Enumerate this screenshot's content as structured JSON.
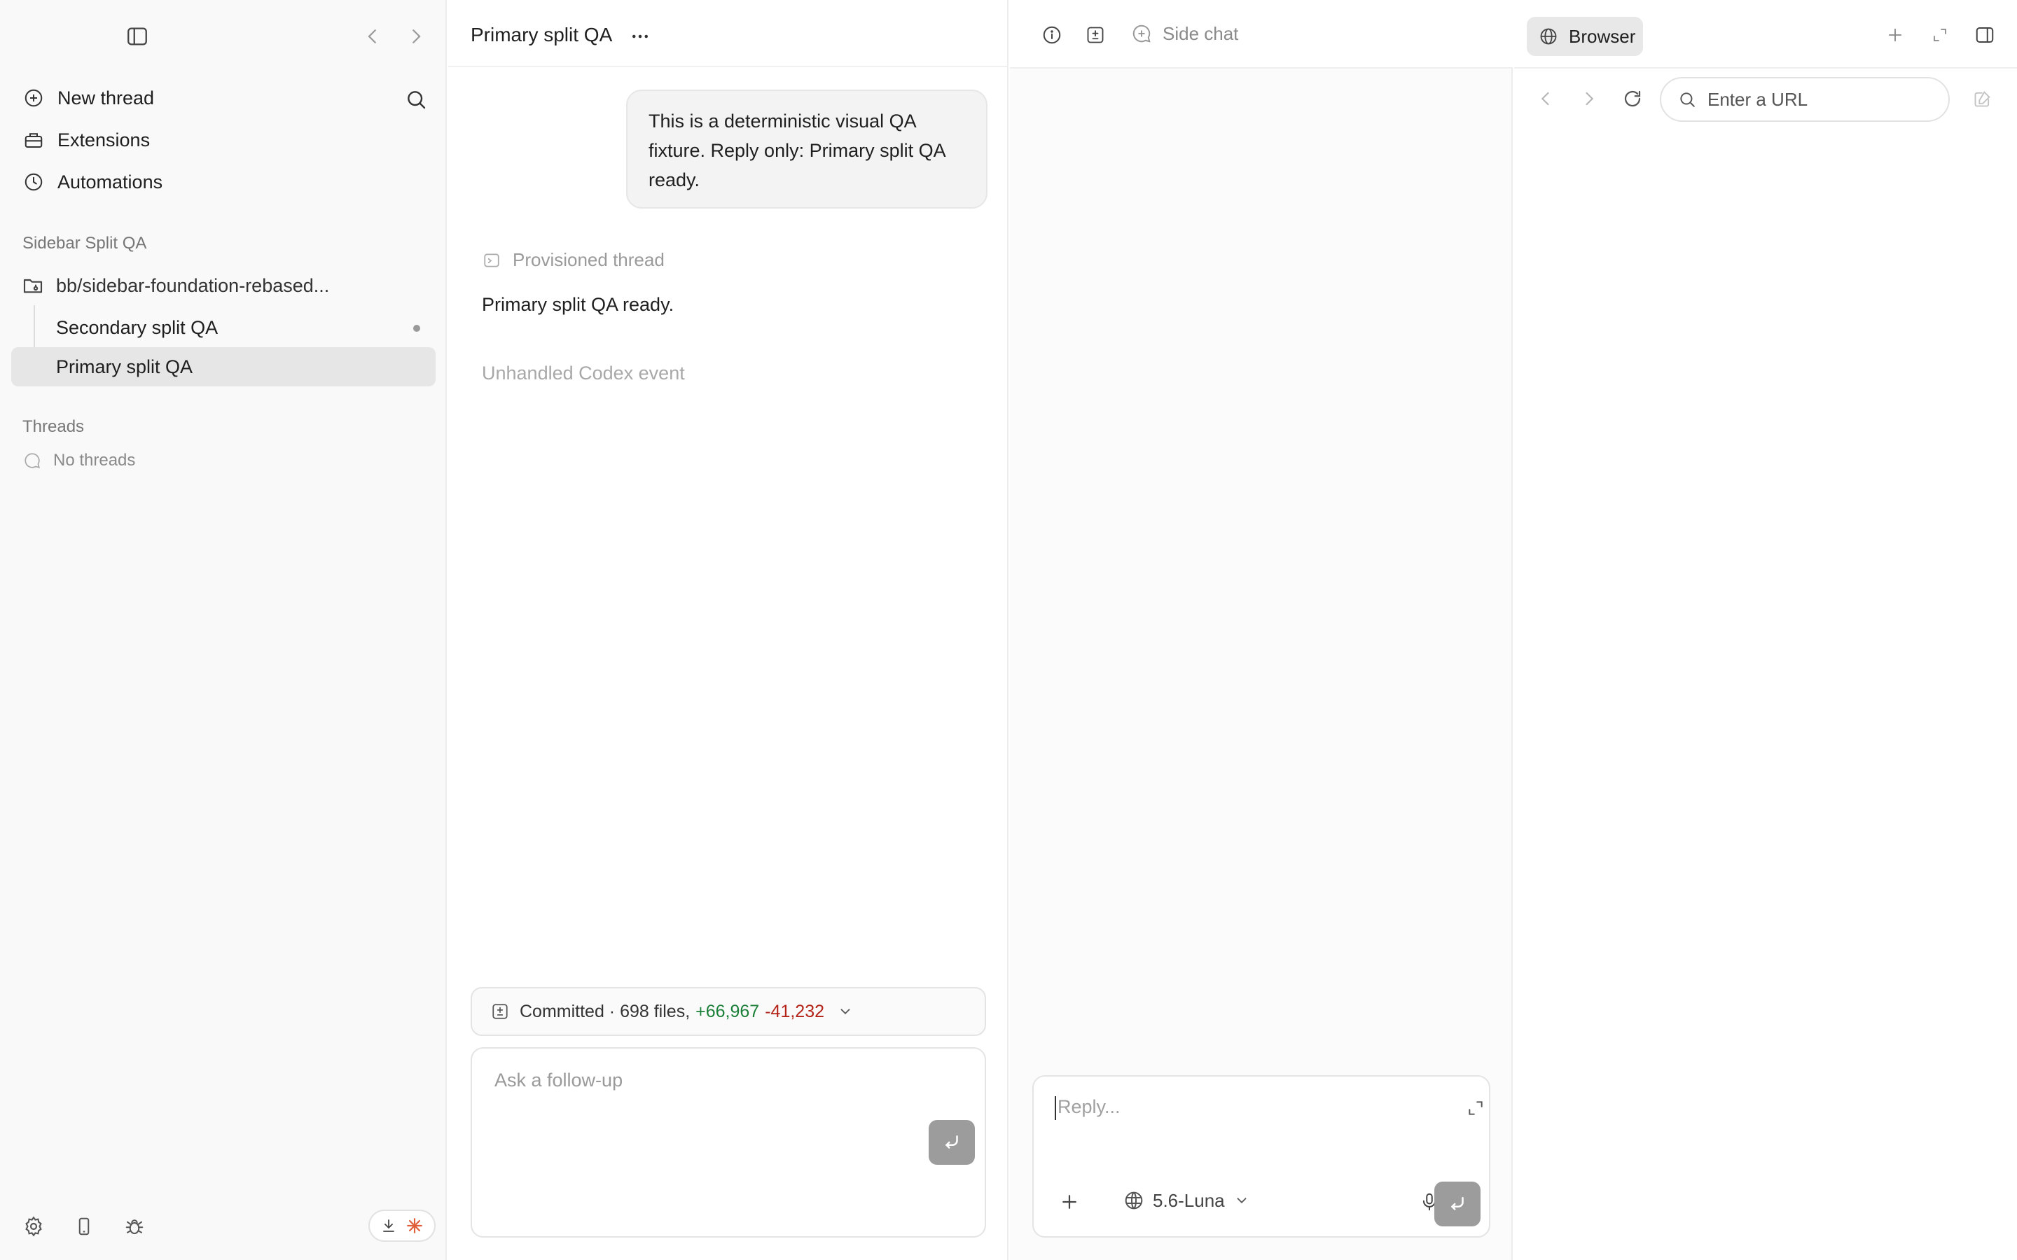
{
  "sidebar": {
    "nav": {
      "new_thread": "New thread",
      "extensions": "Extensions",
      "automations": "Automations"
    },
    "project_label": "Sidebar Split QA",
    "repo_name": "bb/sidebar-foundation-rebased...",
    "threads": [
      {
        "label": "Secondary split QA",
        "active": false,
        "unread": true
      },
      {
        "label": "Primary split QA",
        "active": true,
        "unread": false
      }
    ],
    "threads_label": "Threads",
    "no_threads": "No threads"
  },
  "main": {
    "title": "Primary split QA",
    "user_message": "This is a deterministic visual QA fixture. Reply only: Primary split QA ready.",
    "provisioned_label": "Provisioned thread",
    "assistant_reply": "Primary split QA ready.",
    "unhandled_event": "Unhandled Codex event",
    "commit": {
      "summary": "Committed · 698 files,",
      "additions": "+66,967",
      "deletions": "-41,232"
    },
    "composer_placeholder": "Ask a follow-up"
  },
  "side_chat": {
    "tab_label": "Side chat",
    "composer_placeholder": "Reply...",
    "model": "5.6-Luna"
  },
  "browser": {
    "tab_label": "Browser",
    "url_placeholder": "Enter a URL"
  },
  "colors": {
    "additions": "#1a7f37",
    "deletions": "#b42318",
    "sidebar_bg": "#f9f9f9",
    "active_item": "#e6e6e6",
    "send_button": "#9c9c9c"
  }
}
